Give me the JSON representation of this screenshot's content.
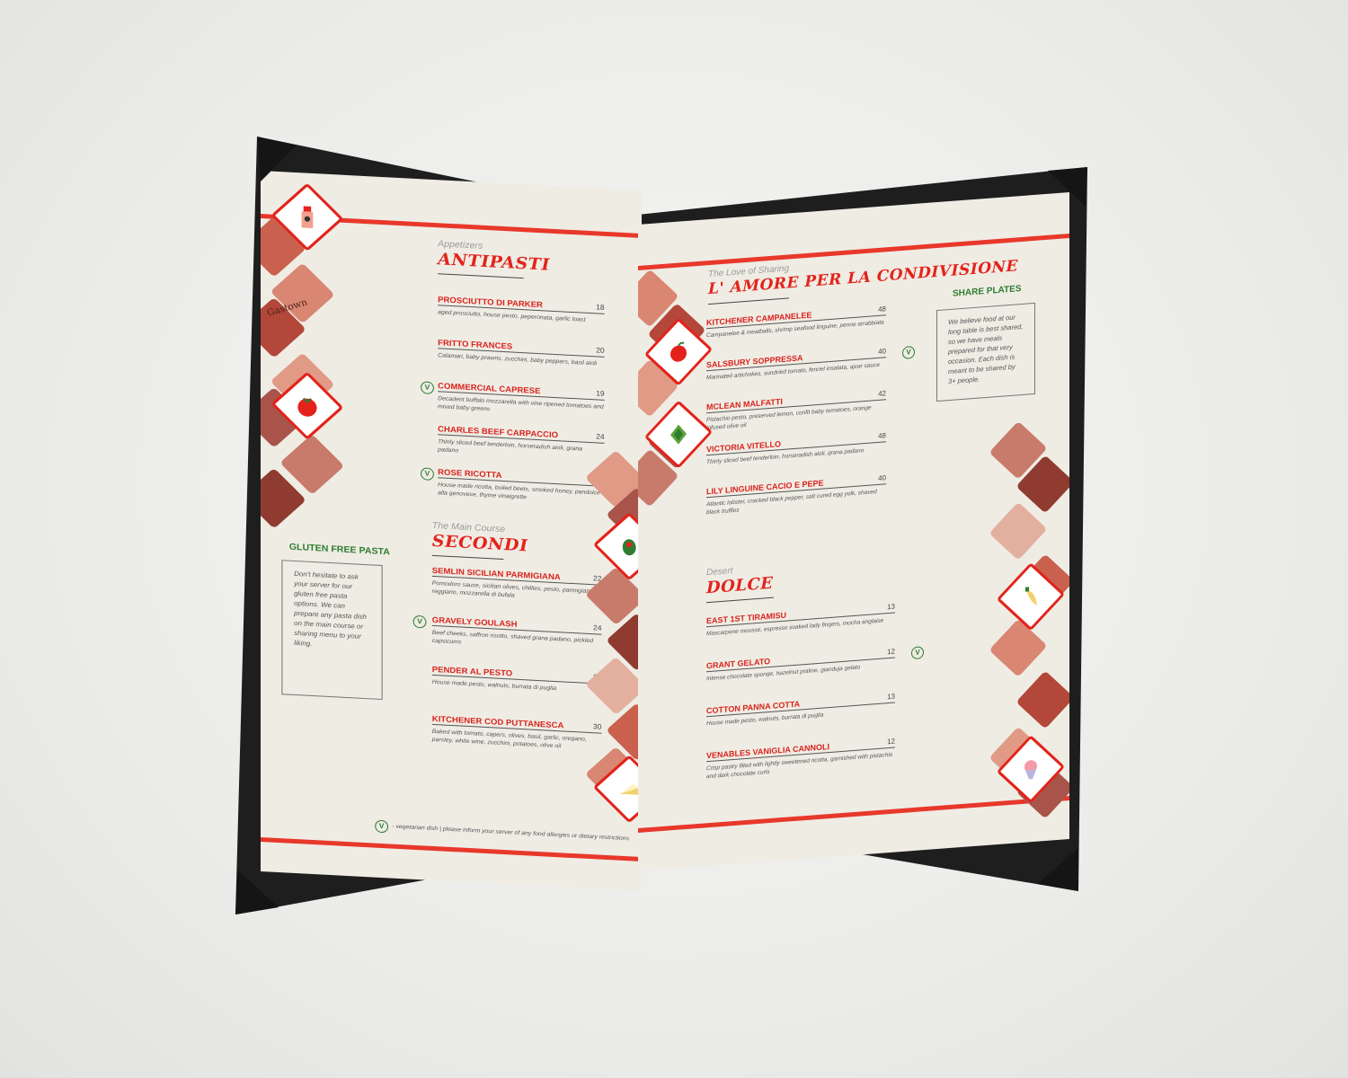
{
  "colors": {
    "accent_red": "#e3231b",
    "veg_green": "#2e7d32",
    "paper": "#efece4",
    "cover": "#1e1e1e"
  },
  "left_page": {
    "antipasti": {
      "eyebrow": "Appetizers",
      "title": "ANTIPASTI",
      "items": [
        {
          "name": "PROSCIUTTO DI PARKER",
          "price": "18",
          "desc": "aged prosciutto, house pesto, peperonata, garlic toast",
          "veg": false
        },
        {
          "name": "FRITTO FRANCES",
          "price": "20",
          "desc": "Calamari, baby prawns, zucchini, baby peppers, basil aioli",
          "veg": false
        },
        {
          "name": "COMMERCIAL CAPRESE",
          "price": "19",
          "desc": "Decadent buffalo mozzarella with vine ripened tomatoes and mixed baby greens",
          "veg": true
        },
        {
          "name": "CHARLES BEEF CARPACCIO",
          "price": "24",
          "desc": "Thinly sliced beef tenderloin, horseradish aioli, grana padano",
          "veg": false
        },
        {
          "name": "ROSE RICOTTA",
          "price": "18",
          "desc": "House made ricotta, boiled beets, smoked honey, pandolce alla genovese, thyme vinaigrette",
          "veg": true
        }
      ]
    },
    "secondi": {
      "eyebrow": "The Main Course",
      "title": "SECONDI",
      "items": [
        {
          "name": "SEMLIN SICILIAN PARMIGIANA",
          "price": "22",
          "desc": "Pomodoro sauce, sicilian olives, chillies, pesto, parmigiano reggiano, mozzarella di bufala",
          "veg": false
        },
        {
          "name": "GRAVELY GOULASH",
          "price": "24",
          "desc": "Beef cheeks, saffron risotto, shaved grana padano, pickled capsicums",
          "veg": true
        },
        {
          "name": "PENDER AL PESTO",
          "price": "28",
          "desc": "House made pesto, walnuts, burrata di puglia",
          "veg": false
        },
        {
          "name": "KITCHENER COD PUTTANESCA",
          "price": "30",
          "desc": "Baked with tomato, capers, olives, basil, garlic, oregano, parsley, white wine, zucchini, potatoes, olive oil",
          "veg": false
        }
      ]
    },
    "gluten_free": {
      "title": "GLUTEN FREE PASTA",
      "text": "Don't hesitate to ask your server for our gluten free pasta options. We can prepare any pasta dish on the main course or sharing menu to your liking."
    },
    "footer": {
      "badge": "V",
      "text": "- vegetarian dish | please inform your server of any food allergies or dietary restrictions"
    }
  },
  "right_page": {
    "sharing": {
      "eyebrow": "The Love of Sharing",
      "title": "L' AMORE PER LA CONDIVISIONE",
      "items": [
        {
          "name": "KITCHENER CAMPANELEE",
          "price": "48",
          "desc": "Campanelee & meatballs, shrimp seafood linguine, penne arrabbiata",
          "veg": false
        },
        {
          "name": "SALSBURY SOPPRESSA",
          "price": "40",
          "desc": "Marinated artichokes, sundried tomato, fennel insalata, ajvar sauce",
          "veg": true
        },
        {
          "name": "MCLEAN MALFATTI",
          "price": "42",
          "desc": "Pistachio pesto, preserved lemon, confit baby tomatoes, orange infused olive oil",
          "veg": false
        },
        {
          "name": "VICTORIA VITELLO",
          "price": "48",
          "desc": "Thinly sliced beef tenderloin, horseradish aioli, grana padano",
          "veg": false
        },
        {
          "name": "LILY LINGUINE CACIO E PEPE",
          "price": "40",
          "desc": "Atlantic lobster, cracked black pepper, salt cured egg yolk, shaved black truffles",
          "veg": false
        }
      ]
    },
    "share_plates": {
      "title": "SHARE PLATES",
      "text": "We believe food at our long table is best shared, so we have meals prepared for that very occasion. Each dish is meant to be shared by 3+ people."
    },
    "dolce": {
      "eyebrow": "Desert",
      "title": "DOLCE",
      "items": [
        {
          "name": "EAST 1ST TIRAMISU",
          "price": "13",
          "desc": "Mascarpone mousse, espresso soaked lady fingers, mocha anglaise",
          "veg": false
        },
        {
          "name": "GRANT GELATO",
          "price": "12",
          "desc": "Intense chocolate sponge, hazelnut praline, gianduja gelato",
          "veg": true
        },
        {
          "name": "COTTON PANNA COTTA",
          "price": "13",
          "desc": "House made pesto, walnuts, burrata di puglia",
          "veg": false
        },
        {
          "name": "VENABLES VANIGLIA CANNOLI",
          "price": "12",
          "desc": "Crisp pastry filled with lightly sweetened ricotta, garnished with pistachio and dark chocolate curls",
          "veg": false
        }
      ]
    }
  },
  "decor": {
    "left_icons": [
      "bottle-icon",
      "tomato-icon",
      "olive-icon",
      "cake-slice-icon"
    ],
    "right_icons": [
      "apple-icon",
      "artichoke-icon",
      "pepper-icon",
      "ice-cream-icon"
    ],
    "stamp_text": "Gastown"
  }
}
